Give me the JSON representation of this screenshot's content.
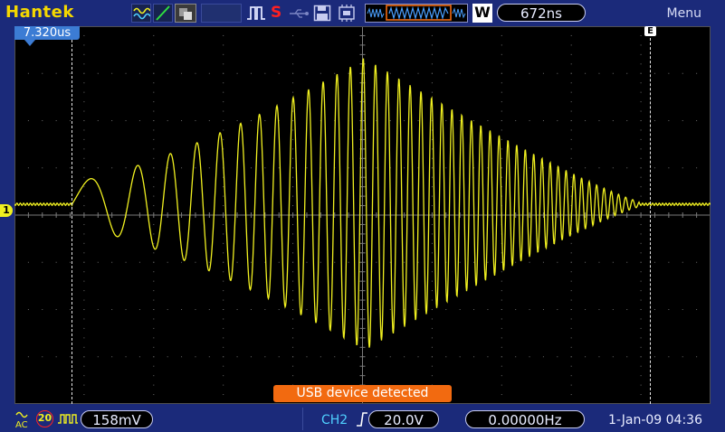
{
  "header": {
    "brand": "Hantek",
    "menu_label": "Menu",
    "timebase": "672ns",
    "trigger_mode_letter": "W"
  },
  "screen": {
    "time_offset": "7.320us",
    "channel_marker": "1",
    "trigger_marker": "E",
    "toast": "USB device detected"
  },
  "footer": {
    "ch1_coupling": "AC",
    "ch1_bw_limit": "20",
    "ch1_volts": "158mV",
    "trig_source": "CH2",
    "trig_level": "20.0V",
    "frequency": "0.00000Hz",
    "datetime": "1-Jan-09 04:36"
  },
  "colors": {
    "frame": "#1b2a7a",
    "trace": "#f0f020",
    "grid": "#6a6a6a",
    "toast": "#f26a10",
    "brand": "#f5d800"
  }
}
